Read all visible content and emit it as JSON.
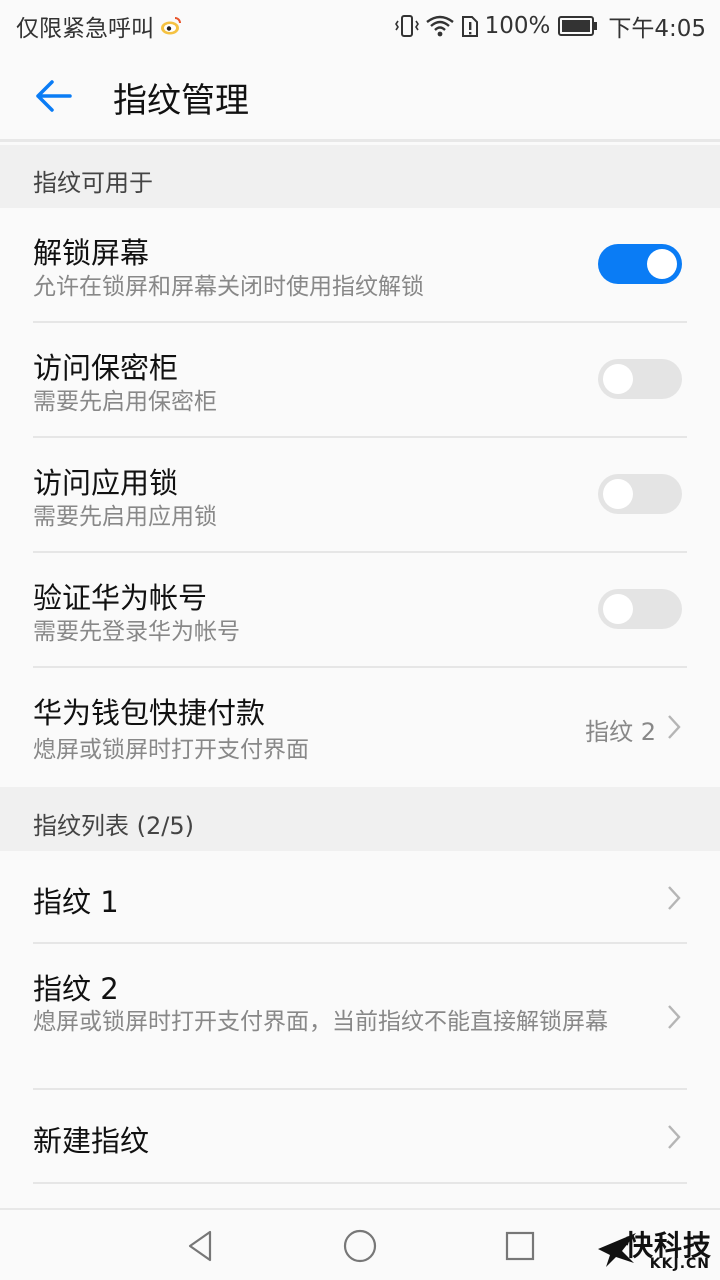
{
  "status_bar": {
    "carrier": "仅限紧急呼叫",
    "battery": "100%",
    "time": "下午4:05",
    "icons": [
      "weibo-icon",
      "vibrate-icon",
      "wifi-icon",
      "sim-alert-icon",
      "battery-icon"
    ]
  },
  "app_bar": {
    "title": "指纹管理",
    "back_icon": "arrow-left-icon"
  },
  "sections": {
    "usage": "指纹可用于",
    "list": "指纹列表 (2/5)"
  },
  "usage_items": [
    {
      "title": "解锁屏幕",
      "subtitle": "允许在锁屏和屏幕关闭时使用指纹解锁",
      "enabled": true
    },
    {
      "title": "访问保密柜",
      "subtitle": "需要先启用保密柜",
      "enabled": false
    },
    {
      "title": "访问应用锁",
      "subtitle": "需要先启用应用锁",
      "enabled": false
    },
    {
      "title": "验证华为帐号",
      "subtitle": "需要先登录华为帐号",
      "enabled": false
    },
    {
      "title": "华为钱包快捷付款",
      "subtitle": "熄屏或锁屏时打开支付界面",
      "value": "指纹 2"
    }
  ],
  "fingerprints": [
    {
      "title": "指纹 1"
    },
    {
      "title": "指纹 2",
      "subtitle": "熄屏或锁屏时打开支付界面，当前指纹不能直接解锁屏幕"
    },
    {
      "title": "新建指纹"
    }
  ],
  "nav_bar": {
    "icons": [
      "back-triangle-icon",
      "home-circle-icon",
      "recents-square-icon"
    ]
  },
  "watermark": {
    "cn": "快科技",
    "en": "KKJ.CN"
  },
  "colors": {
    "accent": "#0a7cf5",
    "toggle_off": "#e4e4e4"
  }
}
